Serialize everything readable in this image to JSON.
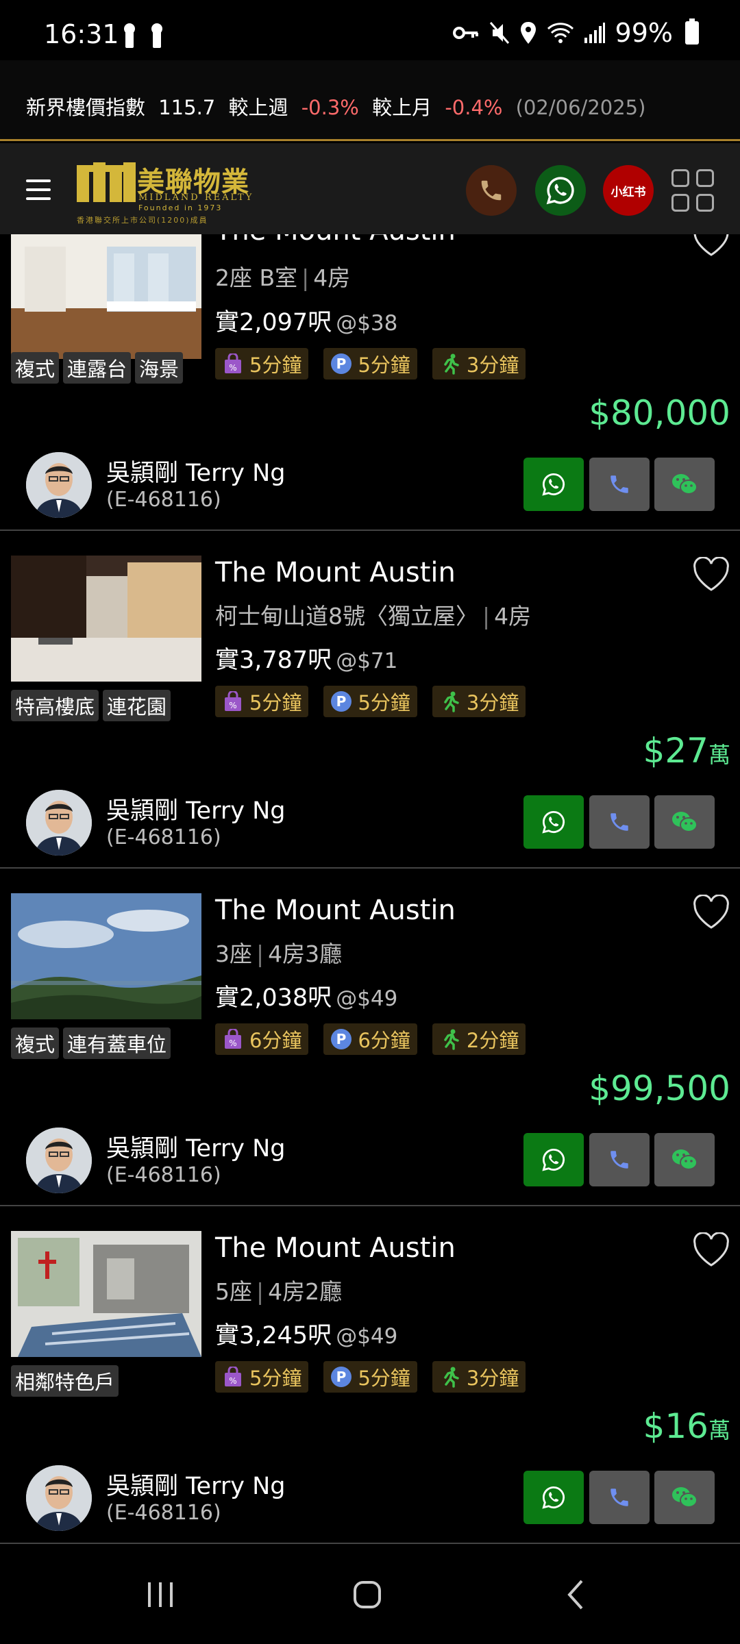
{
  "status_bar": {
    "time": "16:31",
    "battery": "99%"
  },
  "ticker": {
    "label": "新界樓價指數",
    "value": "115.7",
    "week_label": "較上週",
    "week_change": "-0.3%",
    "month_label": "較上月",
    "month_change": "-0.4%",
    "date": "(02/06/2025)"
  },
  "header": {
    "logo_cn": "美聯物業",
    "logo_en": "MIDLAND REALTY",
    "logo_sub": "Founded in 1973",
    "logo_note": "香港聯交所上市公司(1200)成員",
    "xhs_label": "小红书"
  },
  "colors": {
    "accent_gold": "#d4b73a",
    "price_green": "#5dea92",
    "negative_red": "#ff6b6b",
    "whatsapp_green": "#0b7a14"
  },
  "listings": [
    {
      "title": "The Mount Austin",
      "meta_a": "2座 B室",
      "meta_b": "4房",
      "area": "實2,097呎",
      "unit_price": "@$38",
      "chip_shop": "5分鐘",
      "chip_parking": "5分鐘",
      "chip_walk": "3分鐘",
      "tags": [
        "複式",
        "連露台",
        "海景"
      ],
      "price": "$80,000",
      "price_unit": "",
      "agent_name": "吳頴剛 Terry Ng",
      "agent_license": "(E-468116)"
    },
    {
      "title": "The Mount Austin",
      "meta_a": "柯士甸山道8號〈獨立屋〉",
      "meta_b": "4房",
      "area": "實3,787呎",
      "unit_price": "@$71",
      "chip_shop": "5分鐘",
      "chip_parking": "5分鐘",
      "chip_walk": "3分鐘",
      "tags": [
        "特高樓底",
        "連花園"
      ],
      "price": "$27",
      "price_unit": "萬",
      "agent_name": "吳頴剛 Terry Ng",
      "agent_license": "(E-468116)"
    },
    {
      "title": "The Mount Austin",
      "meta_a": "3座",
      "meta_b": "4房3廳",
      "area": "實2,038呎",
      "unit_price": "@$49",
      "chip_shop": "6分鐘",
      "chip_parking": "6分鐘",
      "chip_walk": "2分鐘",
      "tags": [
        "複式",
        "連有蓋車位"
      ],
      "price": "$99,500",
      "price_unit": "",
      "agent_name": "吳頴剛 Terry Ng",
      "agent_license": "(E-468116)"
    },
    {
      "title": "The Mount Austin",
      "meta_a": "5座",
      "meta_b": "4房2廳",
      "area": "實3,245呎",
      "unit_price": "@$49",
      "chip_shop": "5分鐘",
      "chip_parking": "5分鐘",
      "chip_walk": "3分鐘",
      "tags": [
        "相鄰特色戶"
      ],
      "price": "$16",
      "price_unit": "萬",
      "agent_name": "吳頴剛 Terry Ng",
      "agent_license": "(E-468116)"
    }
  ]
}
